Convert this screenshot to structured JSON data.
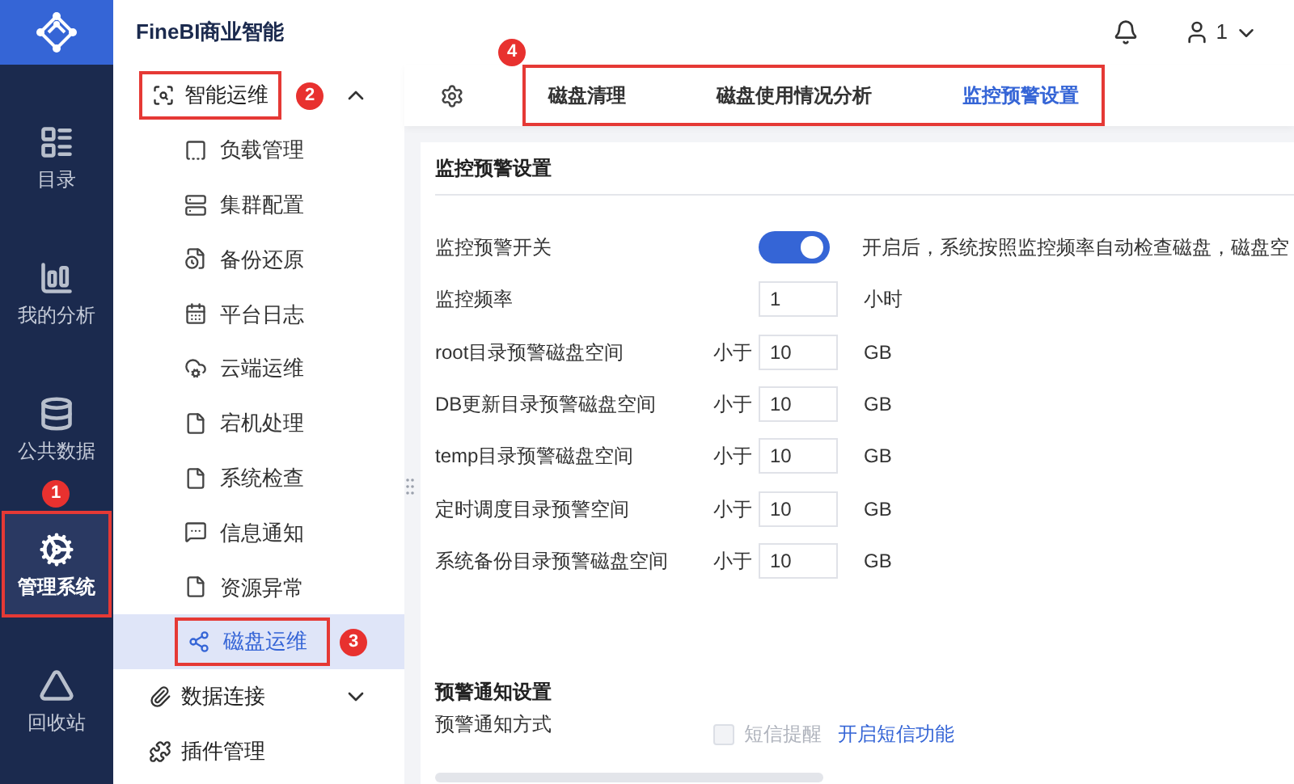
{
  "app": {
    "title": "FineBI商业智能"
  },
  "header": {
    "user": "1"
  },
  "rail": [
    {
      "label": "目录",
      "selected": false
    },
    {
      "label": "我的分析",
      "selected": false
    },
    {
      "label": "公共数据",
      "selected": false
    },
    {
      "label": "管理系统",
      "selected": true,
      "callout": "1"
    },
    {
      "label": "回收站",
      "selected": false
    }
  ],
  "sidebar": {
    "items": [
      {
        "label": "智能运维",
        "expanded": true,
        "callout": "2",
        "children": [
          {
            "label": "负载管理",
            "selected": false
          },
          {
            "label": "集群配置",
            "selected": false
          },
          {
            "label": "备份还原",
            "selected": false
          },
          {
            "label": "平台日志",
            "selected": false
          },
          {
            "label": "云端运维",
            "selected": false
          },
          {
            "label": "宕机处理",
            "selected": false
          },
          {
            "label": "系统检查",
            "selected": false
          },
          {
            "label": "信息通知",
            "selected": false
          },
          {
            "label": "资源异常",
            "selected": false
          },
          {
            "label": "磁盘运维",
            "selected": true,
            "callout": "3"
          }
        ]
      },
      {
        "label": "数据连接",
        "expanded": false
      },
      {
        "label": "插件管理"
      }
    ]
  },
  "tabs": {
    "callout": "4",
    "items": [
      {
        "label": "磁盘清理",
        "selected": false
      },
      {
        "label": "磁盘使用情况分析",
        "selected": false
      },
      {
        "label": "监控预警设置",
        "selected": true
      }
    ]
  },
  "settings": {
    "title": "监控预警设置",
    "rows": [
      {
        "kind": "switch",
        "label": "监控预警开关",
        "on": true,
        "description": "开启后，系统按照监控频率自动检查磁盘，磁盘空"
      },
      {
        "kind": "input",
        "label": "监控频率",
        "value": "1",
        "unit": "小时"
      },
      {
        "kind": "threshold",
        "label": "root目录预警磁盘空间",
        "prefix": "小于",
        "value": "10",
        "unit": "GB"
      },
      {
        "kind": "threshold",
        "label": "DB更新目录预警磁盘空间",
        "prefix": "小于",
        "value": "10",
        "unit": "GB"
      },
      {
        "kind": "threshold",
        "label": "temp目录预警磁盘空间",
        "prefix": "小于",
        "value": "10",
        "unit": "GB"
      },
      {
        "kind": "threshold",
        "label": "定时调度目录预警空间",
        "prefix": "小于",
        "value": "10",
        "unit": "GB"
      },
      {
        "kind": "threshold",
        "label": "系统备份目录预警磁盘空间",
        "prefix": "小于",
        "value": "10",
        "unit": "GB"
      }
    ]
  },
  "notify": {
    "title": "预警通知设置",
    "label": "预警通知方式",
    "option": {
      "label": "短信提醒",
      "checked": false,
      "disabled": true
    },
    "link": "开启短信功能"
  }
}
